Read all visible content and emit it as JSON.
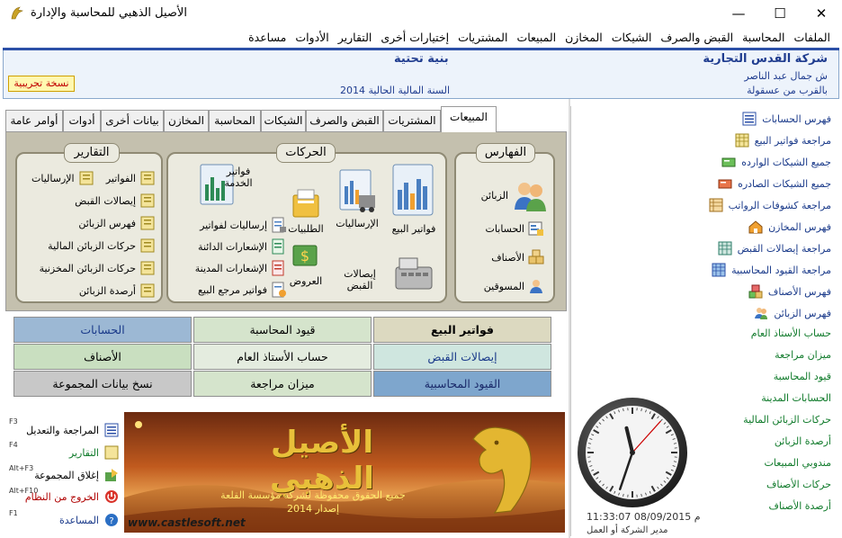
{
  "window": {
    "title": "الأصيل الذهبي للمحاسبة والإدارة",
    "minimize": "—",
    "maximize": "☐",
    "close": "✕"
  },
  "menu": [
    "الملفات",
    "المحاسبة",
    "القبض والصرف",
    "الشيكات",
    "المخازن",
    "المبيعات",
    "المشتريات",
    "إختيارات أخرى",
    "التقارير",
    "الأدوات",
    "مساعدة"
  ],
  "header": {
    "company": "شركة القدس التجارية",
    "address1": "ش جمال عبد الناصر",
    "address2": "بالقرب من عسقولة",
    "welcome": "بنية تحتية",
    "fiscal_year": "السنة المالية الحالية 2014",
    "trial": "نسخة تجريبية"
  },
  "tabs": [
    "المبيعات",
    "المشتريات",
    "القبض والصرف",
    "الشيكات",
    "المحاسبة",
    "المخازن",
    "بيانات أخرى",
    "أدوات",
    "أوامر عامة"
  ],
  "groups": {
    "indexes": {
      "title": "الفهارس",
      "items": [
        "الزبائن",
        "الحسابات",
        "الأصناف",
        "المسوقين"
      ]
    },
    "movements": {
      "title": "الحركات",
      "big": [
        "فواتير البيع",
        "الإرساليات",
        "الطلبيات",
        "فواتير الخدمة",
        "إيصالات القبض",
        "العروض"
      ],
      "small": [
        "إرساليات لفواتير",
        "الإشعارات الدائنة",
        "الإشعارات المدينة",
        "فواتير مرجع البيع"
      ]
    },
    "reports": {
      "title": "التقارير",
      "left": [
        "الإرساليات"
      ],
      "right": [
        "الفواتير",
        "إيصالات القبض",
        "فهرس الزبائن",
        "حركات الزبائن المالية",
        "حركات الزبائن المخزنية",
        "أرصدة الزبائن"
      ]
    }
  },
  "quick_buttons": [
    [
      "فواتير البيع",
      "قيود المحاسبة",
      "الحسابات"
    ],
    [
      "إيصالات القبض",
      "حساب الأستاذ العام",
      "الأصناف"
    ],
    [
      "القيود المحاسبية",
      "ميزان مراجعة",
      "نسخ بيانات المجموعة"
    ]
  ],
  "shortcuts": [
    {
      "label": "المراجعة والتعديل",
      "key": "F3"
    },
    {
      "label": "التقارير",
      "key": "F4"
    },
    {
      "label": "إغلاق المجموعة",
      "key": "Alt+F3"
    },
    {
      "label": "الخروج من النظام",
      "key": "Alt+F10"
    },
    {
      "label": "المساعدة",
      "key": "F1"
    }
  ],
  "banner": {
    "logo_text": "الأصيل الذهبي",
    "copyright": "جميع الحقوق محفوظة لشركة مؤسسة القلعة",
    "version": "إصدار 2014",
    "url": "www.castlesoft.net"
  },
  "right_list": {
    "blue": [
      "فهرس الحسابات",
      "مراجعة فواتير البيع",
      "جميع الشيكات الوارده",
      "جميع الشيكات الصادره",
      "مراجعة كشوفات الرواتب",
      "فهرس المخازن",
      "مراجعة إيصالات القبض",
      "مراجعة القيود المحاسبية",
      "فهرس الأصناف",
      "فهرس الزبائن"
    ],
    "green": [
      "حساب الأستاذ العام",
      "ميزان مراجعة",
      "قيود المحاسبة",
      "الحسابات المدينة",
      "حركات الزبائن المالية",
      "أرصدة الزبائن",
      "مندوبي المبيعات",
      "حركات الأصناف",
      "أرصدة الأصناف"
    ]
  },
  "clock": {
    "time": "11:33:07 08/09/2015 م",
    "user": "مدير الشركة أو العمل",
    "hour": 11,
    "minute": 33,
    "second": 7
  },
  "colors": {
    "accent_blue": "#2b4fa7",
    "panel_bg": "#c4c0ae",
    "group_bg": "#ebeadf",
    "btn_tan": "#dcd9c0",
    "btn_green": "#d5e4cc",
    "btn_blue": "#9cb8d4",
    "btn_teal": "#cfe6df",
    "btn_darkblue": "#7ea6cd",
    "btn_gray": "#c8c8c8"
  }
}
